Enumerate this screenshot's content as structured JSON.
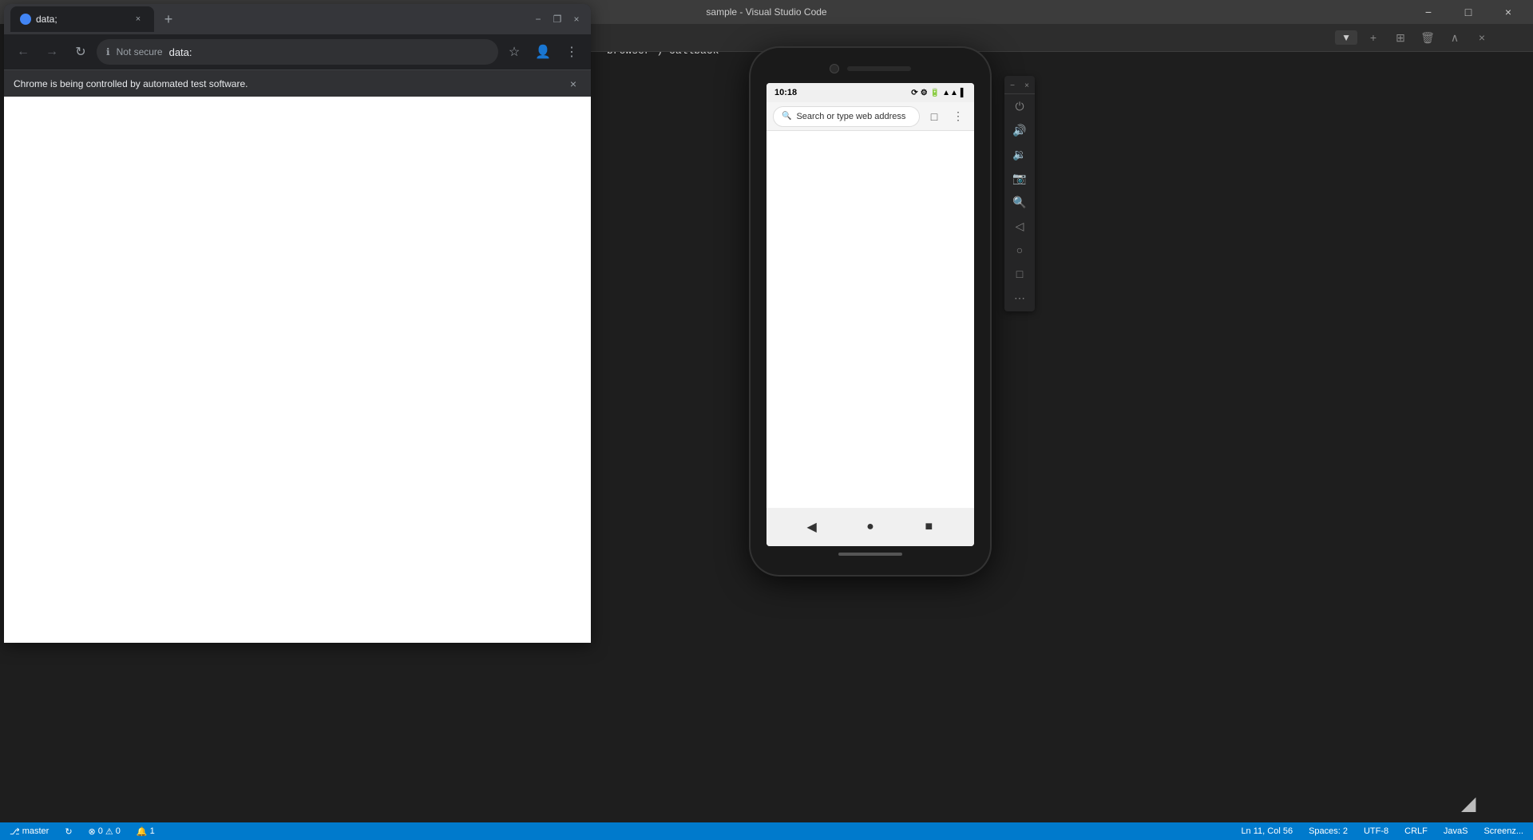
{
  "vscode": {
    "title": "sample - Visual Studio Code",
    "window_controls": {
      "minimize": "−",
      "maximize": "□",
      "close": "×"
    },
    "statusbar": {
      "branch": "master",
      "sync": "",
      "errors": "0",
      "warnings": "0",
      "notifications": "1",
      "ln_col": "Ln 11, Col 56",
      "spaces": "Spaces: 2",
      "encoding": "UTF-8",
      "line_endings": "CRLF",
      "language": "JavaS",
      "screenshot": "Screenz..."
    }
  },
  "chrome": {
    "tab_title": "data;",
    "favicon_color": "#4285f4",
    "url": "data:",
    "security_label": "Not secure",
    "infobar_text": "Chrome is being controlled by automated test software.",
    "window_controls": {
      "minimize": "−",
      "restore": "❐",
      "close": "×"
    }
  },
  "mobile": {
    "time": "10:18",
    "browser_address_placeholder": "Search or type web address",
    "nav": {
      "back": "◀",
      "home": "●",
      "recent": "■"
    }
  },
  "toolbar": {
    "dropdown_label": "▼",
    "add_btn": "+",
    "split_btn": "⊞",
    "delete_btn": "🗑",
    "expand_btn": "∧",
    "close_btn": "×"
  },
  "device_tools": {
    "power": "⏻",
    "volume_up": "🔊",
    "volume_down": "🔉",
    "camera": "📷",
    "zoom": "🔍",
    "back": "◁",
    "home": "○",
    "overview": "□",
    "more": "⋯",
    "close": "×",
    "minimize": "−"
  },
  "code": {
    "line1": "browser') callback"
  }
}
